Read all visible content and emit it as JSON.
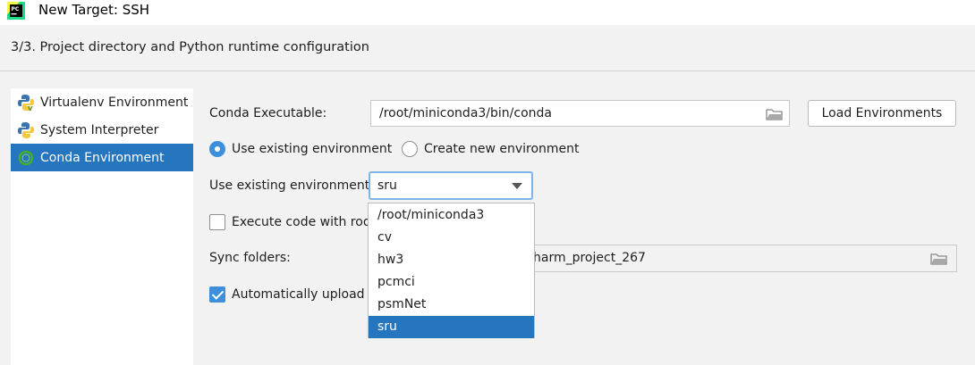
{
  "window": {
    "title": "New Target: SSH"
  },
  "step_title": "3/3. Project directory and Python runtime configuration",
  "sidebar": {
    "items": [
      {
        "label": "Virtualenv Environment",
        "icon": "python-virtualenv-icon"
      },
      {
        "label": "System Interpreter",
        "icon": "python-icon"
      },
      {
        "label": "Conda Environment",
        "icon": "conda-icon",
        "selected": true
      }
    ]
  },
  "conda": {
    "executable_label": "Conda Executable:",
    "executable_value": "/root/miniconda3/bin/conda",
    "load_button": "Load Environments",
    "radio_existing": "Use existing environment",
    "radio_new": "Create new environment",
    "existing_env_label": "Use existing environment:",
    "existing_env_value": "sru",
    "env_options": [
      "/root/miniconda3",
      "cv",
      "hw3",
      "pcmci",
      "psmNet",
      "sru"
    ],
    "execute_root_label": "Execute code with root",
    "sync_folders_label": "Sync folders:",
    "sync_folders_value": "harm_project_267",
    "auto_upload_label": "Automatically upload p"
  },
  "colors": {
    "accent": "#2675bf",
    "radio_checked": "#3d8fdb",
    "focus_border": "#7fb2e8"
  }
}
